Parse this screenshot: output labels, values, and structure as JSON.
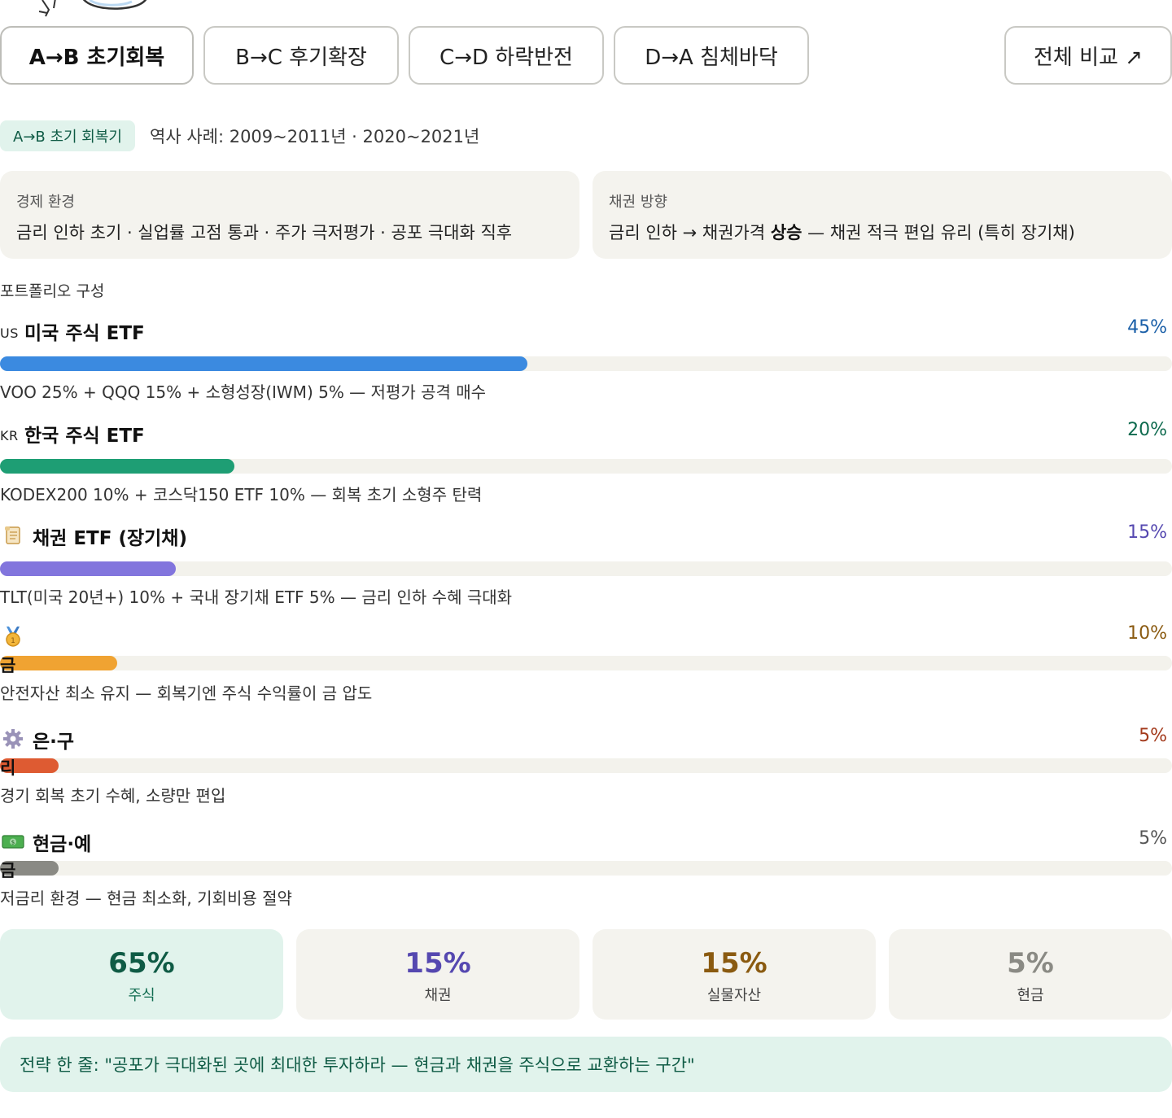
{
  "tabs": [
    {
      "label": "A→B 초기회복",
      "active": true
    },
    {
      "label": "B→C 후기확장",
      "active": false
    },
    {
      "label": "C→D 하락반전",
      "active": false
    },
    {
      "label": "D→A 침체바닥",
      "active": false
    }
  ],
  "compare_button": "전체 비교 ↗",
  "phase_tag": "A→B 초기 회복기",
  "history": "역사 사례: 2009~2011년 · 2020~2021년",
  "economy": {
    "label": "경제 환경",
    "value": "금리 인하 초기 · 실업률 고점 통과 · 주가 극저평가 · 공포 극대화 직후"
  },
  "bond_direction": {
    "label": "채권 방향",
    "prefix": "금리 인하 → 채권가격 ",
    "emphasis": "상승",
    "suffix": " — 채권 적극 편입 유리 (특히 장기채)"
  },
  "portfolio_title": "포트폴리오 구성",
  "portfolio": [
    {
      "flag": "US",
      "name": "미국 주식 ETF",
      "percent": "45%",
      "fraction": 0.45,
      "color": "#3b8ae0",
      "pct_color": "#1a5fa8",
      "desc": "VOO 25% + QQQ 15% + 소형성장(IWM) 5% — 저평가 공격 매수"
    },
    {
      "flag": "KR",
      "name": "한국 주식 ETF",
      "percent": "20%",
      "fraction": 0.2,
      "color": "#1e9e74",
      "pct_color": "#0f6b4f",
      "desc": "KODEX200 10% + 코스닥150 ETF 10% — 회복 초기 소형주 탄력"
    },
    {
      "icon": "scroll-icon",
      "name": "채권 ETF (장기채)",
      "percent": "15%",
      "fraction": 0.15,
      "color": "#8275dd",
      "pct_color": "#5548b0",
      "desc": "TLT(미국 20년+) 10% + 국내 장기채 ETF 5% — 금리 인하 수혜 극대화"
    },
    {
      "icon": "medal-icon",
      "name": "금",
      "percent": "10%",
      "fraction": 0.1,
      "color": "#f0a332",
      "pct_color": "#8a5a10",
      "desc": "안전자산 최소 유지 — 회복기엔 주식 수익률이 금 압도"
    },
    {
      "icon": "gear-icon",
      "name_a": "은·구",
      "name_b": "리",
      "percent": "5%",
      "fraction": 0.05,
      "color": "#de5b32",
      "pct_color": "#a33a1c",
      "desc": "경기 회복 초기 수혜, 소량만 편입"
    },
    {
      "icon": "cash-icon",
      "name_a": "현금·예",
      "name_b": "금",
      "percent": "5%",
      "fraction": 0.05,
      "color": "#8a8a84",
      "pct_color": "#555555",
      "desc": "저금리 환경 — 현금 최소화, 기회비용 절약"
    }
  ],
  "summary": [
    {
      "value": "65%",
      "label": "주식",
      "bg": "#e1f3ec",
      "num_color": "#0f5b45",
      "cap_color": "#0f6b4f"
    },
    {
      "value": "15%",
      "label": "채권",
      "bg": "#f4f3ee",
      "num_color": "#5548b0",
      "cap_color": "#444444"
    },
    {
      "value": "15%",
      "label": "실물자산",
      "bg": "#f4f3ee",
      "num_color": "#8a5a10",
      "cap_color": "#444444"
    },
    {
      "value": "5%",
      "label": "현금",
      "bg": "#f4f3ee",
      "num_color": "#8a8a84",
      "cap_color": "#444444"
    }
  ],
  "strategy": "전략 한 줄: \"공포가 극대화된 곳에 최대한 투자하라 — 현금과 채권을 주식으로 교환하는 구간\""
}
